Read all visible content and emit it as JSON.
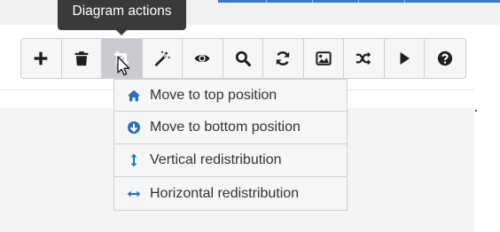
{
  "tooltip": {
    "text": "Diagram actions"
  },
  "toolbar": {
    "buttons": [
      {
        "icon": "plus-icon",
        "active": false
      },
      {
        "icon": "trash-icon",
        "active": false
      },
      {
        "icon": "crop-icon",
        "active": true
      },
      {
        "icon": "magic-wand-icon",
        "active": false
      },
      {
        "icon": "eye-icon",
        "active": false
      },
      {
        "icon": "search-icon",
        "active": false
      },
      {
        "icon": "refresh-icon",
        "active": false
      },
      {
        "icon": "image-icon",
        "active": false
      },
      {
        "icon": "shuffle-icon",
        "active": false
      },
      {
        "icon": "play-icon",
        "active": false
      },
      {
        "icon": "question-icon",
        "active": false
      }
    ]
  },
  "menu": {
    "items": [
      {
        "label": "Move to top position",
        "icon": "home-icon"
      },
      {
        "label": "Move to bottom position",
        "icon": "arrow-circle-down-icon"
      },
      {
        "label": "Vertical redistribution",
        "icon": "arrows-vertical-icon"
      },
      {
        "label": "Horizontal redistribution",
        "icon": "arrows-horizontal-icon"
      }
    ]
  },
  "colors": {
    "icon_dark": "#1f1f1f",
    "icon_blue": "#2a6fb6",
    "tooltip_bg": "#3a3a3a",
    "accent": "#3a78c3"
  }
}
